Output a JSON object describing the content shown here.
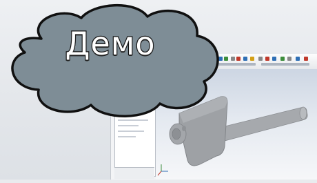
{
  "banner": {
    "text": "Демо"
  },
  "colors": {
    "cloud_fill": "#7e8d96",
    "cloud_outline": "#101010",
    "part_fill": "#a9acb0",
    "viewport_top": "#cdd6e3"
  },
  "icons": {
    "part": "cad-part-icon",
    "cloud": "cloud-shape"
  }
}
